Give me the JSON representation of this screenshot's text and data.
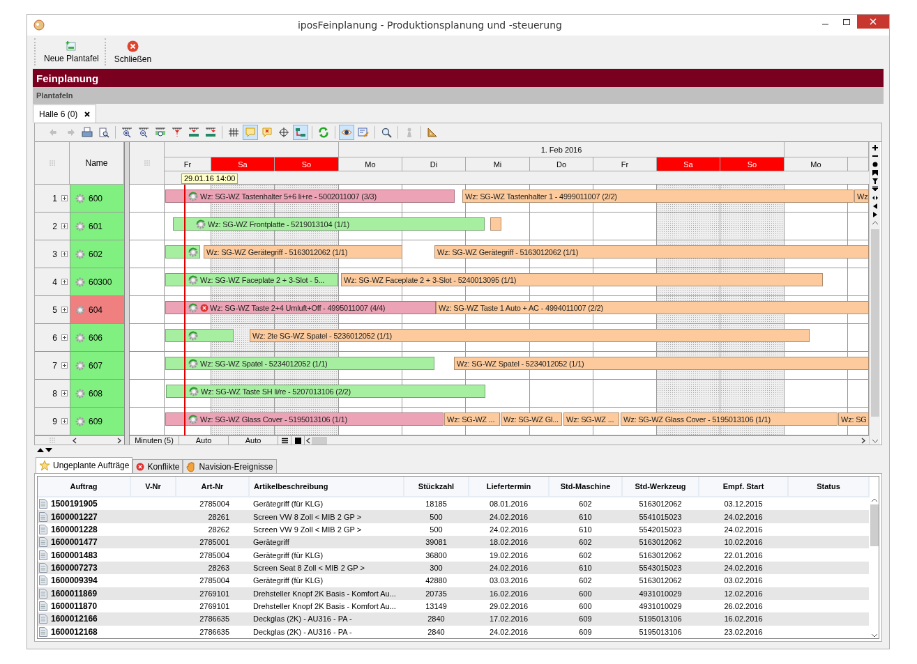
{
  "window": {
    "title": "iposFeinplanung - Produktionsplanung und -steuerung"
  },
  "toolbar": [
    {
      "label": "Neue Plantafel",
      "kind": "new"
    },
    {
      "label": "Schließen",
      "kind": "close"
    }
  ],
  "header": {
    "title": "Feinplanung",
    "subtitle": "Plantafeln"
  },
  "tabs": [
    {
      "label": "Halle 6 (0)",
      "selected": true
    }
  ],
  "gantt_toolbar": [
    {
      "pressed": false,
      "disabled": true
    },
    {
      "pressed": false,
      "disabled": true
    },
    {
      "pressed": false,
      "disabled": false
    },
    {
      "pressed": false,
      "disabled": false
    },
    {
      "pressed": false,
      "disabled": false
    },
    {
      "pressed": false,
      "disabled": false
    },
    {
      "pressed": false,
      "disabled": false
    },
    {
      "pressed": false,
      "disabled": false
    },
    {
      "pressed": false,
      "disabled": false
    },
    {
      "pressed": false,
      "disabled": false
    },
    {
      "pressed": false,
      "disabled": false
    },
    {
      "pressed": true,
      "disabled": false
    },
    {
      "pressed": false,
      "disabled": false
    },
    {
      "pressed": false,
      "disabled": false
    },
    {
      "pressed": true,
      "disabled": false
    },
    {
      "pressed": false,
      "disabled": false
    },
    {
      "pressed": true,
      "disabled": false
    },
    {
      "pressed": false,
      "disabled": false
    },
    {
      "pressed": false,
      "disabled": false
    },
    {
      "pressed": false,
      "disabled": true
    },
    {
      "pressed": false,
      "disabled": false
    }
  ],
  "gantt": {
    "name_header": "Name",
    "month": "1. Feb 2016",
    "days": [
      {
        "label": "Fr",
        "weekend": false
      },
      {
        "label": "Sa",
        "weekend": true
      },
      {
        "label": "So",
        "weekend": true
      },
      {
        "label": "Mo",
        "weekend": false
      },
      {
        "label": "Di",
        "weekend": false
      },
      {
        "label": "Mi",
        "weekend": false
      },
      {
        "label": "Do",
        "weekend": false
      },
      {
        "label": "Fr",
        "weekend": false
      },
      {
        "label": "Sa",
        "weekend": true
      },
      {
        "label": "So",
        "weekend": true
      },
      {
        "label": "Mo",
        "weekend": false
      }
    ],
    "now_marker": "29.01.16 14:00",
    "machines": [
      {
        "number": "1",
        "name": "600",
        "color": "#80f080",
        "bars": [
          {
            "text": "Wz: SG-WZ Tastenhalter 5+6 li+re - 5002011007 (3/3)",
            "color": "#eca3b6",
            "gear": true,
            "conflict": false
          },
          {
            "text": "Wz: SG-WZ Tastenhalter 1 - 4999011007 (2/2)",
            "color": "#fcca9c",
            "gear": false,
            "conflict": false
          },
          {
            "text": "Wz",
            "color": "#fcca9c",
            "gear": false,
            "conflict": false
          }
        ]
      },
      {
        "number": "2",
        "name": "601",
        "color": "#80f080",
        "bars": [
          {
            "text": "Wz: SG-WZ Frontplatte - 5219013104 (1/1)",
            "color": "#a6eea0",
            "gear": true,
            "conflict": false
          },
          {
            "color": "#fcca9c"
          }
        ]
      },
      {
        "number": "3",
        "name": "602",
        "color": "#80f080",
        "bars": [
          {
            "color": "#a6eea0",
            "gear": true,
            "conflict": false
          },
          {
            "text": "Wz: SG-WZ Gerätegriff - 5163012062 (1/1)",
            "color": "#fcca9c",
            "gear": false,
            "conflict": false
          },
          {
            "text": "Wz: SG-WZ Gerätegriff - 5163012062 (1/1)",
            "color": "#fcca9c",
            "gear": false,
            "conflict": false
          }
        ]
      },
      {
        "number": "4",
        "name": "60300",
        "color": "#80f080",
        "bars": [
          {
            "text": "Wz: SG-WZ Faceplate 2 + 3-Slot - 5...",
            "color": "#a6eea0",
            "gear": true,
            "conflict": false
          },
          {
            "text": "Wz: SG-WZ Faceplate 2 + 3-Slot - 5240013095 (1/1)",
            "color": "#fcca9c",
            "gear": false,
            "conflict": false
          }
        ]
      },
      {
        "number": "5",
        "name": "604",
        "color": "#f08080",
        "bars": [
          {
            "text": "Wz: SG-WZ Taste 2+4 Umluft+Off - 4995011007 (4/4)",
            "color": "#eca3b6",
            "gear": true,
            "conflict": true
          },
          {
            "text": "Wz: SG-WZ Taste 1 Auto + AC - 4994011007 (2/2)",
            "color": "#fcca9c",
            "gear": false,
            "conflict": false
          }
        ]
      },
      {
        "number": "6",
        "name": "606",
        "color": "#80f080",
        "bars": [
          {
            "color": "#a6eea0",
            "gear": true,
            "conflict": false
          },
          {
            "text": "Wz: 2te SG-WZ Spatel - 5236012052 (1/1)",
            "color": "#fcca9c",
            "gear": false,
            "conflict": false
          }
        ]
      },
      {
        "number": "7",
        "name": "607",
        "color": "#80f080",
        "bars": [
          {
            "text": "Wz: SG-WZ Spatel - 5234012052 (1/1)",
            "color": "#a6eea0",
            "gear": true,
            "conflict": false
          },
          {
            "text": "Wz: SG-WZ Spatel - 5234012052 (1/1)",
            "color": "#fcca9c",
            "gear": false,
            "conflict": false
          }
        ]
      },
      {
        "number": "8",
        "name": "608",
        "color": "#80f080",
        "bars": [
          {
            "text": "Wz: SG-WZ Taste SH li/re - 5207013106 (2/2)",
            "color": "#a6eea0",
            "gear": true,
            "conflict": false
          }
        ]
      },
      {
        "number": "9",
        "name": "609",
        "color": "#80f080",
        "bars": [
          {
            "text": "Wz: SG-WZ Glass Cover - 5195013106 (1/1)",
            "color": "#eca3b6",
            "gear": true,
            "conflict": false
          },
          {
            "text": "Wz: SG-WZ ...",
            "color": "#fcca9c",
            "gear": false,
            "conflict": false
          },
          {
            "text": "Wz: SG-WZ Gl...",
            "color": "#fcca9c",
            "gear": false,
            "conflict": false
          },
          {
            "text": "Wz: SG-WZ ...",
            "color": "#fcca9c",
            "gear": false,
            "conflict": false
          },
          {
            "text": "Wz: SG-WZ Glass Cover - 5195013106 (1/1)",
            "color": "#fcca9c",
            "gear": false,
            "conflict": false
          },
          {
            "text": "Wz: SG",
            "color": "#fcca9c",
            "gear": false,
            "conflict": false
          }
        ]
      }
    ],
    "footer": {
      "unit": "Minuten (5)",
      "mode_1": "Auto",
      "mode_2": "Auto"
    }
  },
  "lower_tabs": [
    {
      "label": "Ungeplante Aufträge",
      "kind": "star",
      "selected": true
    },
    {
      "label": "Konflikte",
      "kind": "conflict",
      "selected": false
    },
    {
      "label": "Navision-Ereignisse",
      "kind": "hand",
      "selected": false
    }
  ],
  "table": {
    "columns": [
      "Auftrag",
      "V-Nr",
      "Art-Nr",
      "Artikelbeschreibung",
      "Stückzahl",
      "Liefertermin",
      "Std-Maschine",
      "Std-Werkzeug",
      "Empf. Start",
      "Status"
    ],
    "rows": [
      [
        "1500191905",
        "",
        "2785004",
        "Gerätegriff (für KLG)",
        "18185",
        "08.01.2016",
        "602",
        "5163012062",
        "03.12.2015",
        ""
      ],
      [
        "1600001227",
        "",
        "28261",
        "Screen VW 8 Zoll < MIB 2 GP >",
        "500",
        "24.02.2016",
        "610",
        "5541015023",
        "24.02.2016",
        ""
      ],
      [
        "1600001228",
        "",
        "28262",
        "Screen VW 9 Zoll < MIB 2 GP >",
        "500",
        "24.02.2016",
        "610",
        "5542015023",
        "24.02.2016",
        ""
      ],
      [
        "1600001477",
        "",
        "2785001",
        "Gerätegriff",
        "39081",
        "18.02.2016",
        "602",
        "5163012062",
        "10.02.2016",
        ""
      ],
      [
        "1600001483",
        "",
        "2785004",
        "Gerätegriff (für KLG)",
        "36800",
        "19.02.2016",
        "602",
        "5163012062",
        "22.01.2016",
        ""
      ],
      [
        "1600007273",
        "",
        "28263",
        "Screen Seat 8 Zoll < MIB 2 GP >",
        "300",
        "24.02.2016",
        "610",
        "5543015023",
        "24.02.2016",
        ""
      ],
      [
        "1600009394",
        "",
        "2785004",
        "Gerätegriff (für KLG)",
        "42880",
        "03.03.2016",
        "602",
        "5163012062",
        "03.02.2016",
        ""
      ],
      [
        "1600011869",
        "",
        "2769101",
        "Drehsteller Knopf 2K Basis - Komfort Au...",
        "20735",
        "16.02.2016",
        "600",
        "4931010029",
        "12.02.2016",
        ""
      ],
      [
        "1600011870",
        "",
        "2769101",
        "Drehsteller Knopf 2K Basis - Komfort Au...",
        "13149",
        "29.02.2016",
        "600",
        "4931010029",
        "26.02.2016",
        ""
      ],
      [
        "1600012166",
        "",
        "2786635",
        "Deckglas (2K)  - AU316 - PA -",
        "2840",
        "17.02.2016",
        "609",
        "5195013106",
        "16.02.2016",
        ""
      ],
      [
        "1600012168",
        "",
        "2786635",
        "Deckglas (2K)  - AU316 - PA -",
        "2840",
        "24.02.2016",
        "609",
        "5195013106",
        "23.02.2016",
        ""
      ]
    ]
  }
}
